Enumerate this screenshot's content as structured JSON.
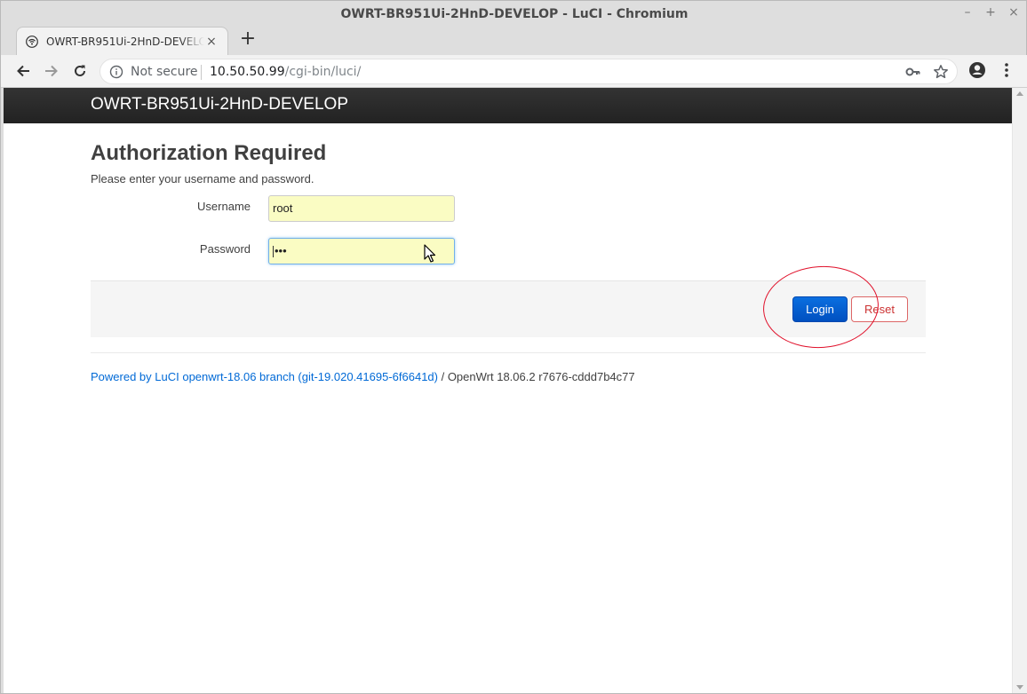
{
  "window": {
    "title": "OWRT-BR951Ui-2HnD-DEVELOP - LuCI - Chromium",
    "controls": [
      "–",
      "+",
      "×"
    ]
  },
  "tab": {
    "label": "OWRT-BR951Ui-2HnD-DEVELOP",
    "close": "×"
  },
  "newtab": "+",
  "omnibox": {
    "security_text": "Not secure",
    "url_host": "10.50.50.99",
    "url_path": "/cgi-bin/luci/"
  },
  "header": {
    "brand": "OWRT-BR951Ui-2HnD-DEVELOP"
  },
  "login": {
    "title": "Authorization Required",
    "description": "Please enter your username and password.",
    "username_label": "Username",
    "username_value": "root",
    "password_label": "Password",
    "password_value": "•••",
    "login_button": "Login",
    "reset_button": "Reset"
  },
  "footer": {
    "link_text": "Powered by LuCI openwrt-18.06 branch (git-19.020.41695-6f6641d)",
    "rest_text": " / OpenWrt 18.06.2 r7676-cddd7b4c77"
  },
  "colors": {
    "header_bg": "#2a2a2a",
    "input_autofill": "#fafcc3",
    "login_button": "#0a60d8",
    "reset_border": "#d66666",
    "link": "#0069d6",
    "annotation": "#e0102a"
  }
}
